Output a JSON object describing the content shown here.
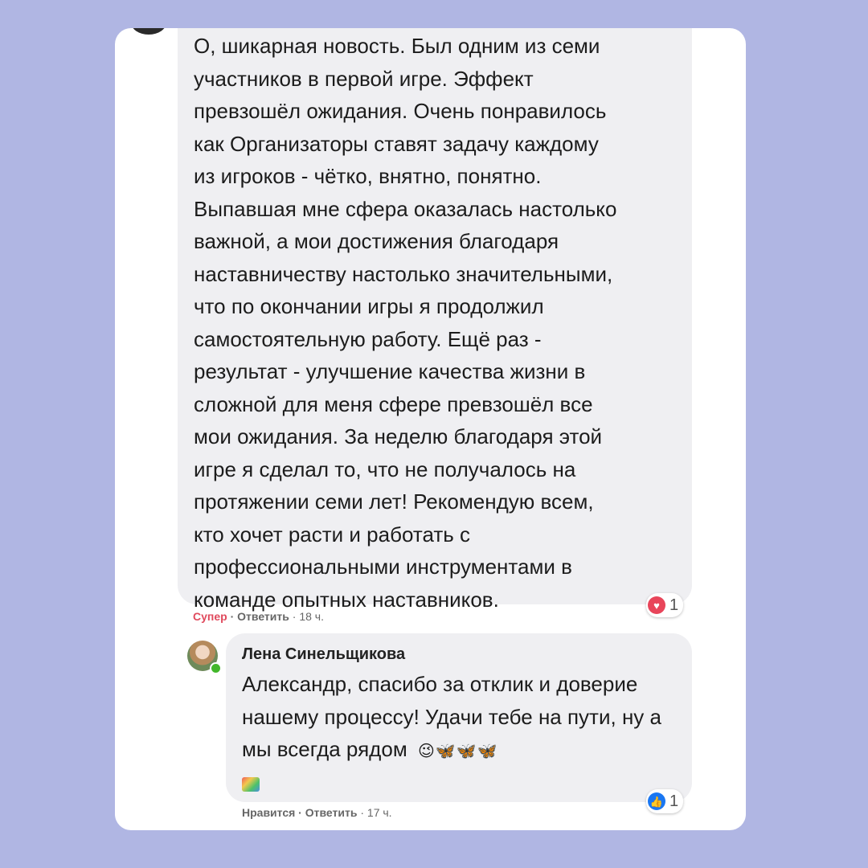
{
  "comment": {
    "text": "О, шикарная новость. Был одним из семи\nучастников в первой игре. Эффект\nпревзошёл ожидания. Очень понравилось\nкак Организаторы ставят задачу каждому\nиз игроков - чётко, внятно, понятно.\nВыпавшая мне сфера оказалась настолько\nважной, а мои достижения благодаря\nнаставничеству настолько значительными,\nчто по окончании игры я продолжил\nсамостоятельную работу. Ещё раз -\nрезультат - улучшение качества жизни в\nсложной для меня сфере превзошёл все\nмои ожидания. За неделю благодаря этой\nигре я сделал то, что не получалось на\nпротяжении семи лет! Рекомендую всем,\nкто хочет расти и работать с\nпрофессиональными инструментами в\nкоманде опытных наставников.",
    "reaction_icon": "heart-icon",
    "reaction_count": "1",
    "react_label": "Супер",
    "separator": " · ",
    "reply_label": "Ответить",
    "time": "18 ч."
  },
  "reply": {
    "author": "Лена Синельщикова",
    "text": "Александр, спасибо за отклик и доверие нашему процессу! Удачи тебе на пути, ну а мы всегда рядом",
    "emojis": "😉🦋🦋🦋",
    "reaction_icon": "like-icon",
    "reaction_count": "1",
    "react_label": "Нравится",
    "separator": " · ",
    "reply_label": "Ответить",
    "time": "17 ч."
  },
  "colors": {
    "background": "#b0b6e3",
    "bubble": "#efeff2",
    "heart": "#e8455a",
    "like": "#1a77f2"
  }
}
